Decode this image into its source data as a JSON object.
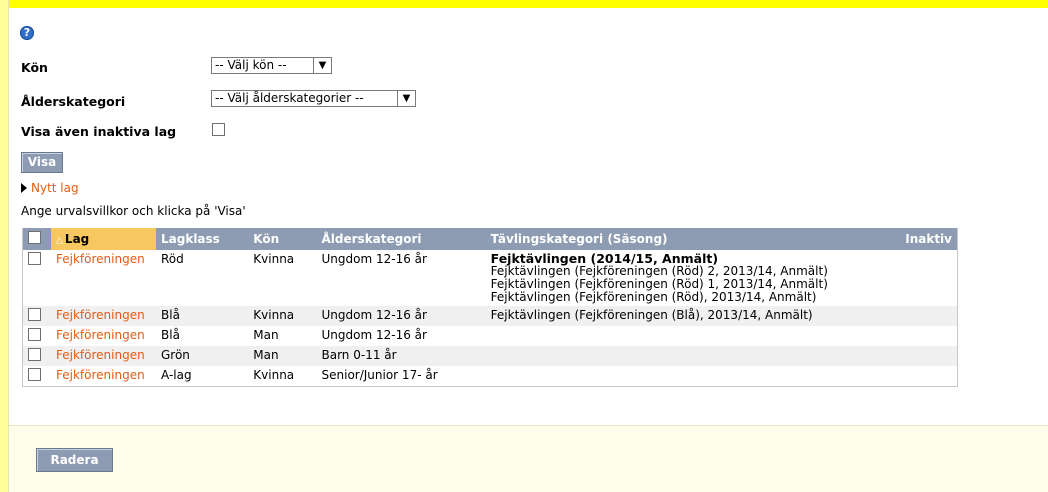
{
  "form": {
    "help_icon": "?",
    "gender_label": "Kön",
    "gender_select": "-- Välj kön --",
    "age_label": "Ålderskategori",
    "age_select": "-- Välj ålderskategorier --",
    "inactive_label": "Visa även inaktiva lag",
    "show_button": "Visa",
    "new_team_link": "Nytt lag",
    "hint": "Ange urvalsvillkor och klicka på 'Visa'"
  },
  "table": {
    "headers": {
      "lag": "Lag",
      "lagklass": "Lagklass",
      "kon": "Kön",
      "alder": "Ålderskategori",
      "tavling": "Tävlingskategori (Säsong)",
      "inaktiv": "Inaktiv"
    },
    "rows": [
      {
        "lag": "Fejkföreningen",
        "lagklass": "Röd",
        "kon": "Kvinna",
        "alder": "Ungdom 12-16 år",
        "competition_main": "Fejktävlingen (2014/15, Anmält)",
        "competitions": [
          "Fejktävlingen (Fejkföreningen (Röd) 2, 2013/14, Anmält)",
          "Fejktävlingen (Fejkföreningen (Röd) 1, 2013/14, Anmält)",
          "Fejktävlingen (Fejkföreningen (Röd), 2013/14, Anmält)"
        ]
      },
      {
        "lag": "Fejkföreningen",
        "lagklass": "Blå",
        "kon": "Kvinna",
        "alder": "Ungdom 12-16 år",
        "competition_main": "",
        "competitions": [
          "Fejktävlingen (Fejkföreningen (Blå), 2013/14, Anmält)"
        ]
      },
      {
        "lag": "Fejkföreningen",
        "lagklass": "Blå",
        "kon": "Man",
        "alder": "Ungdom 12-16 år",
        "competition_main": "",
        "competitions": []
      },
      {
        "lag": "Fejkföreningen",
        "lagklass": "Grön",
        "kon": "Man",
        "alder": "Barn 0-11 år",
        "competition_main": "",
        "competitions": []
      },
      {
        "lag": "Fejkföreningen",
        "lagklass": "A-lag",
        "kon": "Kvinna",
        "alder": "Senior/Junior 17- år",
        "competition_main": "",
        "competitions": []
      }
    ]
  },
  "footer": {
    "delete_button": "Radera"
  },
  "colors": {
    "header": "#8d9cb3",
    "sorted_header": "#f7c860",
    "link": "#e35b12",
    "top_bar": "#ffff00"
  }
}
